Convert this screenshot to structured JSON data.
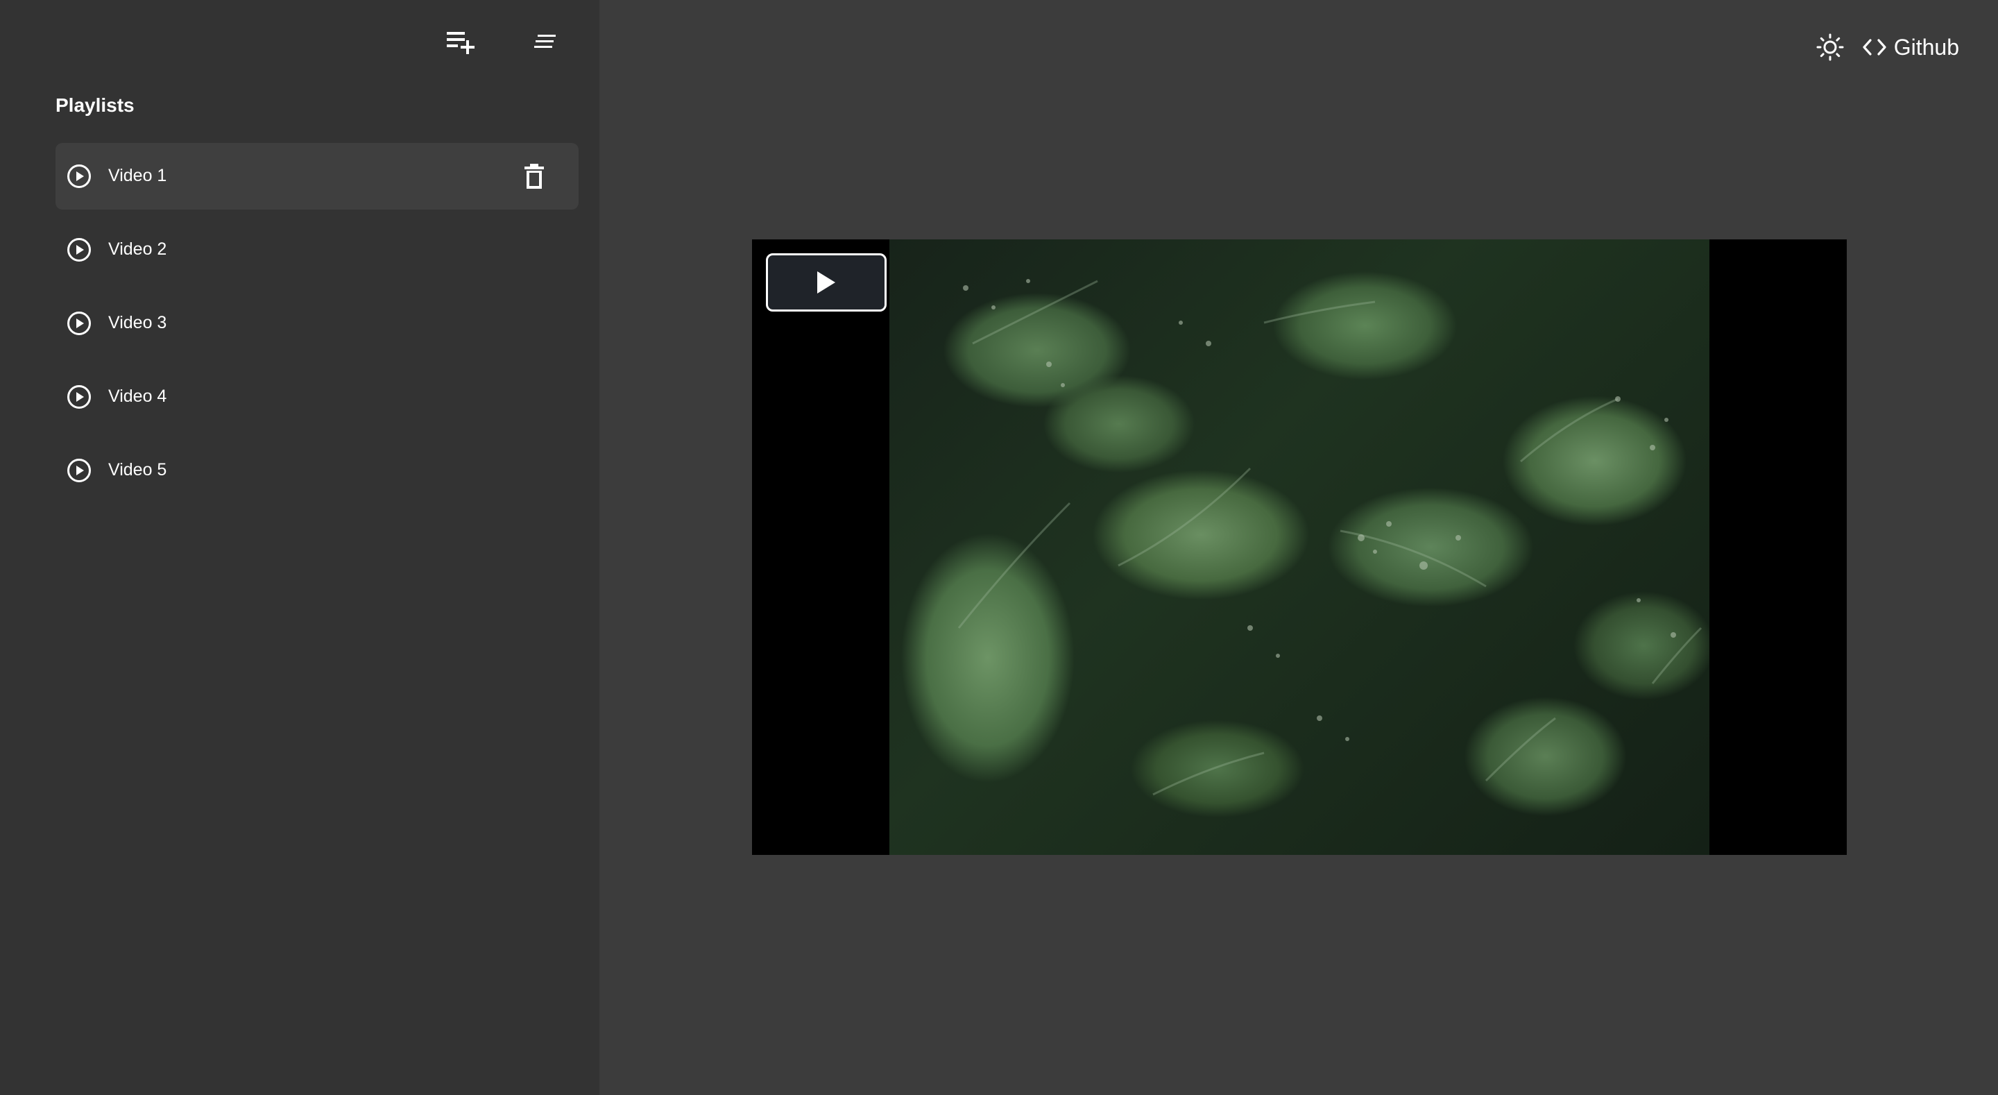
{
  "sidebar": {
    "toolbar": {
      "add_icon": "playlist-add-icon",
      "sort_icon": "sort-lines-icon"
    },
    "heading": "Playlists",
    "items": [
      {
        "label": "Video 1",
        "icon": "play-circle-icon",
        "active": true,
        "action_icon": "trash-icon"
      },
      {
        "label": "Video 2",
        "icon": "play-circle-icon",
        "active": false
      },
      {
        "label": "Video 3",
        "icon": "play-circle-icon",
        "active": false
      },
      {
        "label": "Video 4",
        "icon": "play-circle-icon",
        "active": false
      },
      {
        "label": "Video 5",
        "icon": "play-circle-icon",
        "active": false
      }
    ]
  },
  "header": {
    "theme_icon": "sun-icon",
    "github_icon": "code-icon",
    "github_label": "Github"
  },
  "player": {
    "big_play_icon": "play-icon",
    "poster": "green leaves with water droplets"
  },
  "colors": {
    "sidebar_bg": "#333333",
    "main_bg": "#3c3c3c",
    "active_item_bg": "#3f3f3f",
    "player_bg": "#000000",
    "play_button_bg": "#1f2329",
    "text": "#ffffff"
  }
}
